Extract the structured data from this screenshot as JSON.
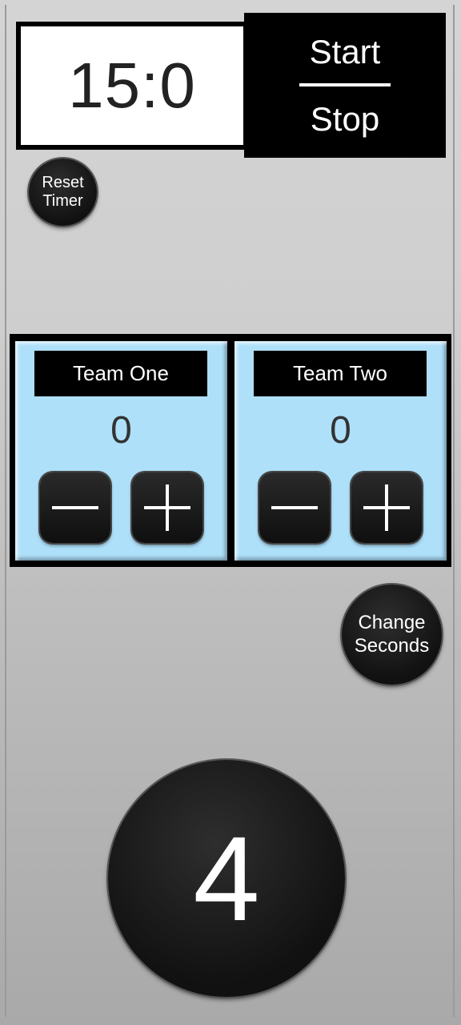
{
  "timer": {
    "display": "15:0"
  },
  "start_stop": {
    "start_label": "Start",
    "stop_label": "Stop"
  },
  "reset": {
    "line1": "Reset",
    "line2": "Timer"
  },
  "teams": [
    {
      "name": "Team One",
      "score": "0"
    },
    {
      "name": "Team Two",
      "score": "0"
    }
  ],
  "change_seconds": {
    "line1": "Change",
    "line2": "Seconds"
  },
  "seconds_button": {
    "value": "4"
  },
  "icons": {
    "minus": "minus-icon",
    "plus": "plus-icon"
  }
}
